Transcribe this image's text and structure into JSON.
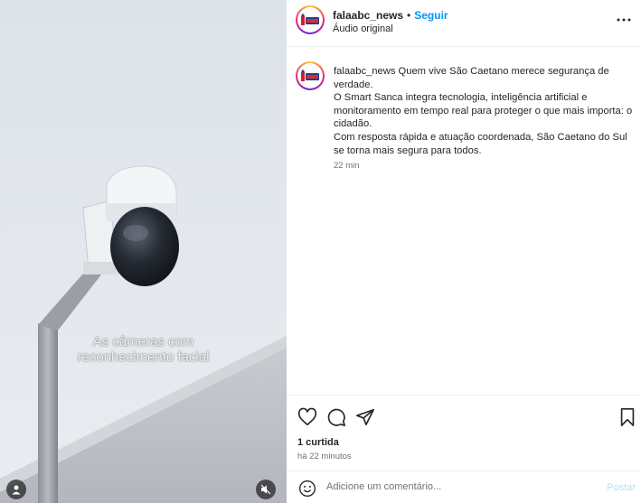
{
  "media": {
    "caption_line1": "As câmeras com",
    "caption_line2": "reconhecimento facial",
    "icons": [
      "user-tag-icon",
      "muted-speaker-icon"
    ]
  },
  "header": {
    "username": "falaabc_news",
    "separator": "•",
    "follow_label": "Seguir",
    "subtitle": "Áudio original",
    "more_icon": "more-horizontal-icon"
  },
  "comment": {
    "username": "falaabc_news",
    "text_line1": "Quem vive São Caetano merece segurança de verdade.",
    "text_line2": "O Smart Sanca integra tecnologia, inteligência artificial e monitoramento em tempo real para proteger o que mais importa: o cidadão.",
    "text_line3": "Com resposta rápida e atuação coordenada, São Caetano do Sul se torna mais segura para todos.",
    "time": "22 min"
  },
  "actions": {
    "icons": [
      "heart-icon",
      "comment-icon",
      "share-icon",
      "bookmark-icon"
    ],
    "likes": "1 curtida",
    "posted": "há 22 minutos"
  },
  "comment_bar": {
    "placeholder": "Adicione um comentário...",
    "post_label": "Postar"
  },
  "colors": {
    "accent": "#0095f6",
    "post_disabled": "#b2dffc",
    "muted_text": "#737373"
  }
}
